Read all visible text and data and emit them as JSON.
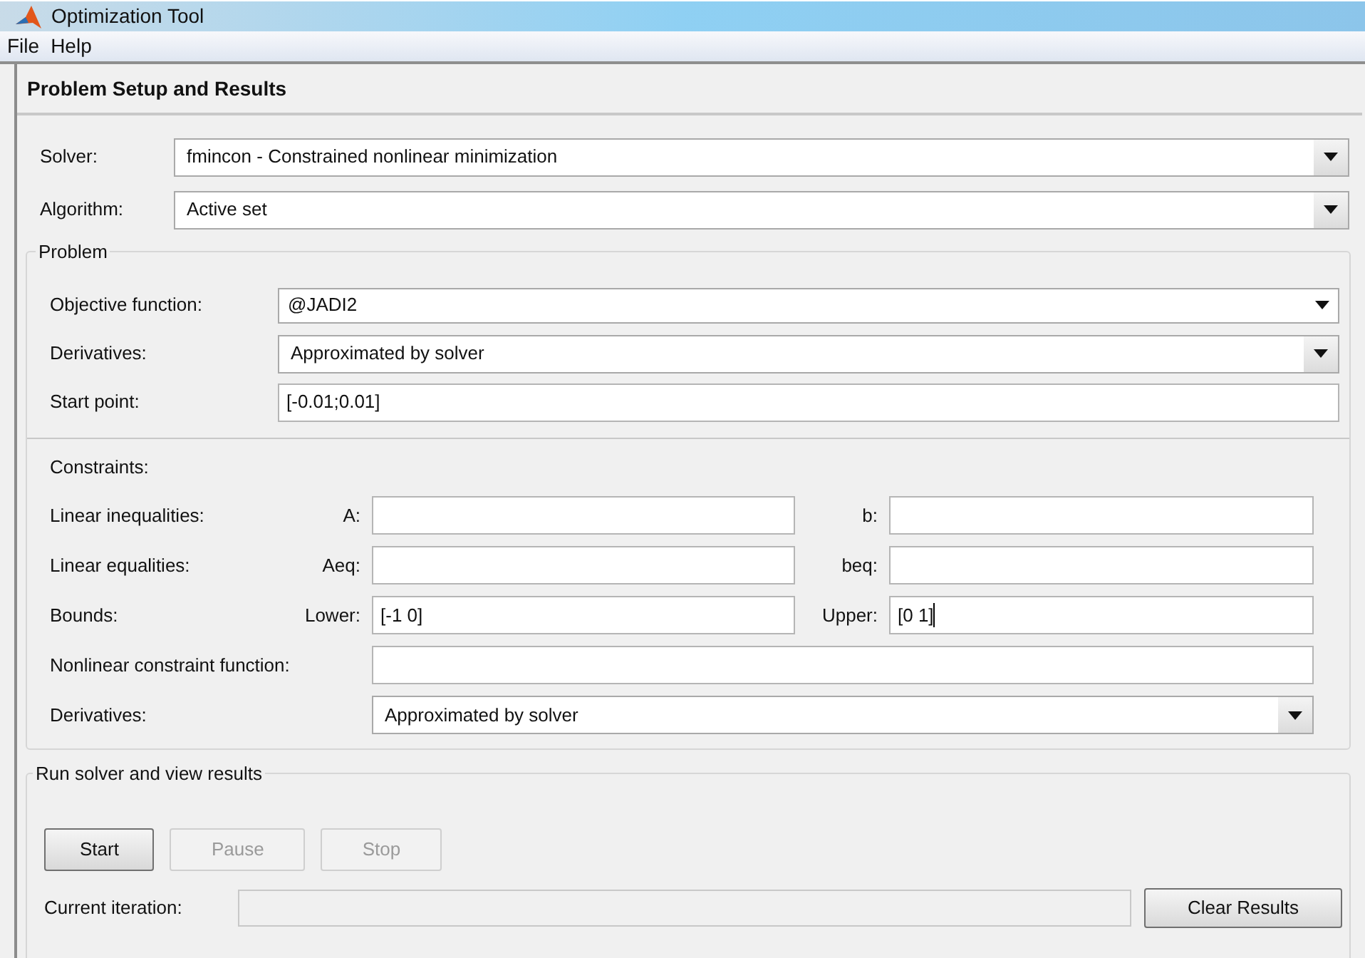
{
  "window": {
    "title": "Optimization Tool"
  },
  "menu": [
    {
      "label": "File"
    },
    {
      "label": "Help"
    }
  ],
  "panel": {
    "title": "Problem Setup and Results"
  },
  "solver": {
    "label": "Solver:",
    "value": "fmincon - Constrained nonlinear minimization"
  },
  "algorithm": {
    "label": "Algorithm:",
    "value": "Active set"
  },
  "problem": {
    "legend": "Problem",
    "fields": [
      {
        "kind": "combo",
        "label": "Objective function:",
        "value": "@JADI2"
      },
      {
        "kind": "dropdown",
        "label": "Derivatives:",
        "value": "Approximated by solver"
      },
      {
        "kind": "text",
        "label": "Start point:",
        "value": "[-0.01;0.01]"
      }
    ]
  },
  "constraints": {
    "heading": "Constraints:",
    "pairs": [
      {
        "label": "Linear inequalities:",
        "left_label": "A:",
        "right_label": "b:"
      },
      {
        "label": "Linear equalities:",
        "left_label": "Aeq:",
        "right_label": "beq:"
      },
      {
        "label": "Bounds:",
        "left_label": "Lower:",
        "left_value": "[-1 0]",
        "right_label": "Upper:",
        "right_value": "[0 1]"
      }
    ],
    "nonlinear": {
      "label": "Nonlinear constraint function:"
    },
    "derivatives": {
      "label": "Derivatives:",
      "value": "Approximated by solver"
    }
  },
  "run": {
    "legend": "Run solver and view results",
    "buttons": [
      {
        "label": "Start",
        "disabled": false
      },
      {
        "label": "Pause",
        "disabled": true
      },
      {
        "label": "Stop",
        "disabled": true
      }
    ],
    "iteration_label": "Current iteration:",
    "clear_button": "Clear Results"
  }
}
